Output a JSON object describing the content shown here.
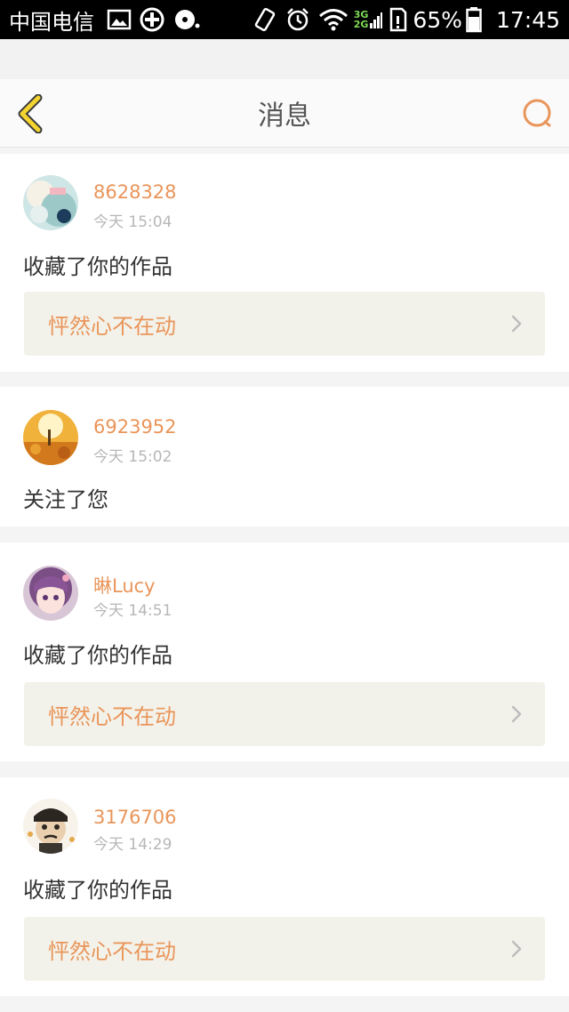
{
  "status_bar": {
    "carrier": "中国电信",
    "network_3g": "3G",
    "network_2g": "2G",
    "battery": "65%",
    "time": "17:45",
    "icons": [
      "image-icon",
      "plus-circle-icon",
      "disc-icon",
      "vibrate-icon",
      "alarm-icon",
      "wifi-icon",
      "signal-icon",
      "sim-icon",
      "battery-icon"
    ]
  },
  "header": {
    "title": "消息",
    "back_icon": "chevron-left-icon",
    "search_icon": "search-icon"
  },
  "colors": {
    "accent": "#e9955a",
    "back_arrow": "#f3d430",
    "timestamp": "#b7b7b7",
    "work_box_bg": "#f3f2ea"
  },
  "messages": [
    {
      "username": "8628328",
      "time": "今天 15:04",
      "action": "收藏了你的作品",
      "work_title": "怦然心不在动"
    },
    {
      "username": "6923952",
      "time": "今天 15:02",
      "action": "关注了您"
    },
    {
      "username": "晽Lucy",
      "time": "今天 14:51",
      "action": "收藏了你的作品",
      "work_title": "怦然心不在动"
    },
    {
      "username": "3176706",
      "time": "今天 14:29",
      "action": "收藏了你的作品",
      "work_title": "怦然心不在动"
    }
  ]
}
